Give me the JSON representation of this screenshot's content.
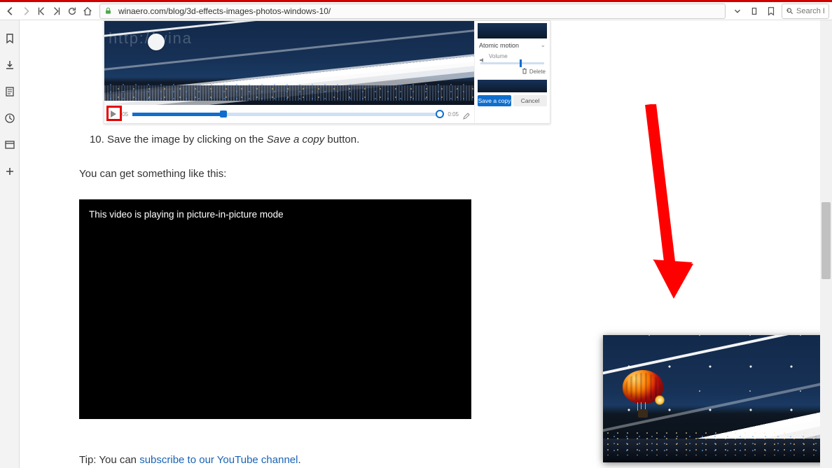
{
  "toolbar": {
    "url": "winaero.com/blog/3d-effects-images-photos-windows-10/",
    "search_placeholder": "Search B"
  },
  "article": {
    "step_number": "10",
    "step_text_a": "Save the image by clicking on the ",
    "step_em": "Save a copy",
    "step_text_b": " button.",
    "para1": "You can get something like this:",
    "tip_prefix": "Tip: You can ",
    "tip_link": "subscribe to our YouTube channel",
    "tip_suffix": "."
  },
  "appshot": {
    "effect_label": "Atomic motion",
    "volume_label": "Volume",
    "delete_label": "Delete",
    "save_label": "Save a copy",
    "cancel_label": "Cancel",
    "time_start": ":05",
    "time_end": "0:05",
    "watermark": "http://wina"
  },
  "video": {
    "pip_msg": "This video is playing in picture-in-picture mode"
  }
}
